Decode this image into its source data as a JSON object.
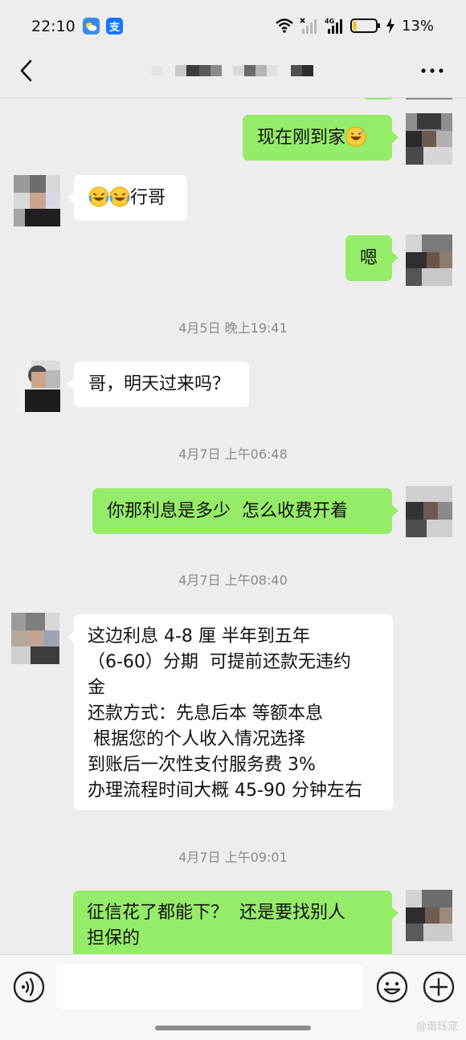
{
  "status_bar": {
    "time": "22:10",
    "app_icons": [
      "weather-app-icon",
      "alipay-icon"
    ],
    "alipay_glyph": "支",
    "battery_percent": "13%",
    "network_label": "4G",
    "battery_level": 0.13
  },
  "nav": {
    "back_icon": "chevron-left-icon",
    "more_icon": "more-dots-icon"
  },
  "messages": [
    {
      "side": "right",
      "lines": [
        "现在刚到家"
      ],
      "trailing_emoji": "grinning-sweat"
    },
    {
      "side": "left",
      "leading_emoji": "crying-laughing x2",
      "lines": [
        "行哥"
      ]
    },
    {
      "side": "right",
      "lines": [
        "嗯"
      ]
    },
    {
      "type": "timestamp",
      "text": "4月5日 晚上19:41"
    },
    {
      "side": "left",
      "lines": [
        "哥，明天过来吗？"
      ]
    },
    {
      "type": "timestamp",
      "text": "4月7日 上午06:48"
    },
    {
      "side": "right",
      "lines": [
        "你那利息是多少  怎么收费开着"
      ]
    },
    {
      "type": "timestamp",
      "text": "4月7日 上午08:40"
    },
    {
      "side": "left",
      "lines": [
        "这边利息 4-8 厘 半年到五年",
        "（6-60）分期  可提前还款无违约",
        "金",
        "还款方式：先息后本 等额本息",
        " 根据您的个人收入情况选择",
        "到账后一次性支付服务费 3%",
        "办理流程时间大概 45-90 分钟左右"
      ]
    },
    {
      "type": "timestamp",
      "text": "4月7日 上午09:01"
    },
    {
      "side": "right",
      "lines": [
        "征信花了都能下？  还是要找别人",
        "担保的"
      ]
    }
  ],
  "input_bar": {
    "voice_icon": "voice-icon",
    "emoji_icon": "emoji-icon",
    "plus_icon": "plus-icon",
    "input_value": "",
    "watermark": "@谐珏宠"
  },
  "colors": {
    "background": "#ededed",
    "outgoing_bubble": "#95ec69",
    "incoming_bubble": "#ffffff",
    "timestamp_text": "#8a8a8a"
  }
}
